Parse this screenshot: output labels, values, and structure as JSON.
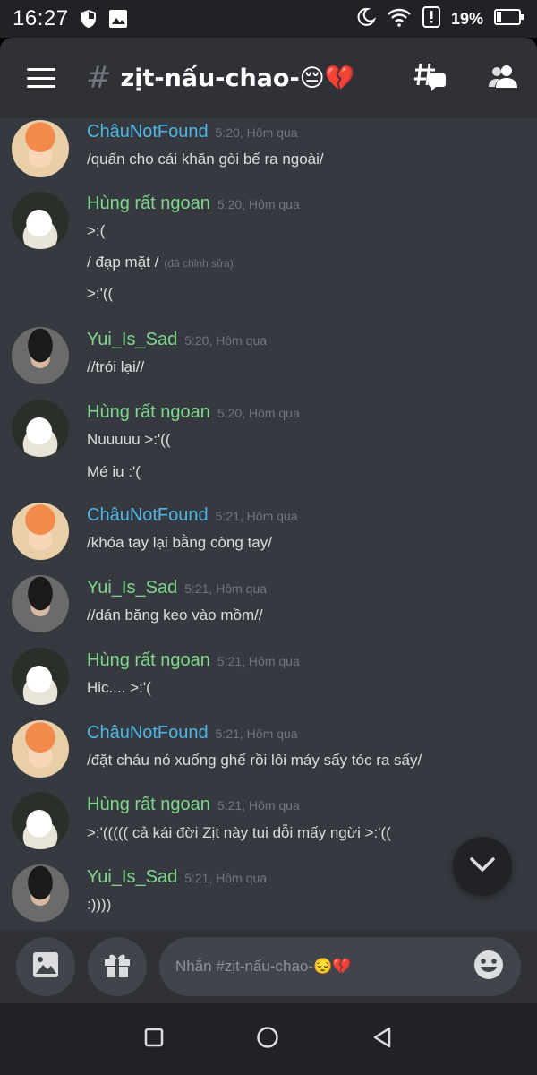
{
  "status_bar": {
    "time": "16:27",
    "battery": "19%"
  },
  "header": {
    "hash": "#",
    "channel": "zịt-nấu-chao-😔💔"
  },
  "messages": [
    {
      "user": "ChâuNotFound",
      "color": "#4fb6e3",
      "time": "5:20, Hôm qua",
      "avatar": "chau",
      "lines": [
        "/quấn cho cái khăn gòi bế ra ngoài/"
      ]
    },
    {
      "user": "Hùng rất ngoan",
      "color": "#7fd88a",
      "time": "5:20, Hôm qua",
      "avatar": "duck",
      "lines": [
        ">:(",
        "/ đạp mặt /",
        ">:'(("
      ],
      "edited": "(đã chỉnh sửa)"
    },
    {
      "user": "Yui_Is_Sad",
      "color": "#7fd88a",
      "time": "5:20, Hôm qua",
      "avatar": "yui",
      "lines": [
        "//trói lại//"
      ]
    },
    {
      "user": "Hùng rất ngoan",
      "color": "#7fd88a",
      "time": "5:20, Hôm qua",
      "avatar": "duck",
      "lines": [
        "Nuuuuu >:'((",
        "Mé iu :'("
      ]
    },
    {
      "user": "ChâuNotFound",
      "color": "#4fb6e3",
      "time": "5:21, Hôm qua",
      "avatar": "chau",
      "lines": [
        "/khóa tay lại bằng còng tay/"
      ]
    },
    {
      "user": "Yui_Is_Sad",
      "color": "#7fd88a",
      "time": "5:21, Hôm qua",
      "avatar": "yui",
      "lines": [
        "//dán băng keo vào mồm//"
      ]
    },
    {
      "user": "Hùng rất ngoan",
      "color": "#7fd88a",
      "time": "5:21, Hôm qua",
      "avatar": "duck",
      "lines": [
        "Hic.... >:'("
      ]
    },
    {
      "user": "ChâuNotFound",
      "color": "#4fb6e3",
      "time": "5:21, Hôm qua",
      "avatar": "chau",
      "lines": [
        "/đặt cháu nó xuống ghế rồi lôi máy sấy tóc ra sấy/"
      ]
    },
    {
      "user": "Hùng rất ngoan",
      "color": "#7fd88a",
      "time": "5:21, Hôm qua",
      "avatar": "duck",
      "lines": [
        ">:'((((( cả kái đời Zịt này tui dỗi mấy ngừi >:'(("
      ]
    },
    {
      "user": "Yui_Is_Sad",
      "color": "#7fd88a",
      "time": "5:21, Hôm qua",
      "avatar": "yui",
      "lines": [
        ":))))"
      ]
    }
  ],
  "composer": {
    "placeholder": "Nhắn #zịt-nấu-chao-😔💔"
  }
}
